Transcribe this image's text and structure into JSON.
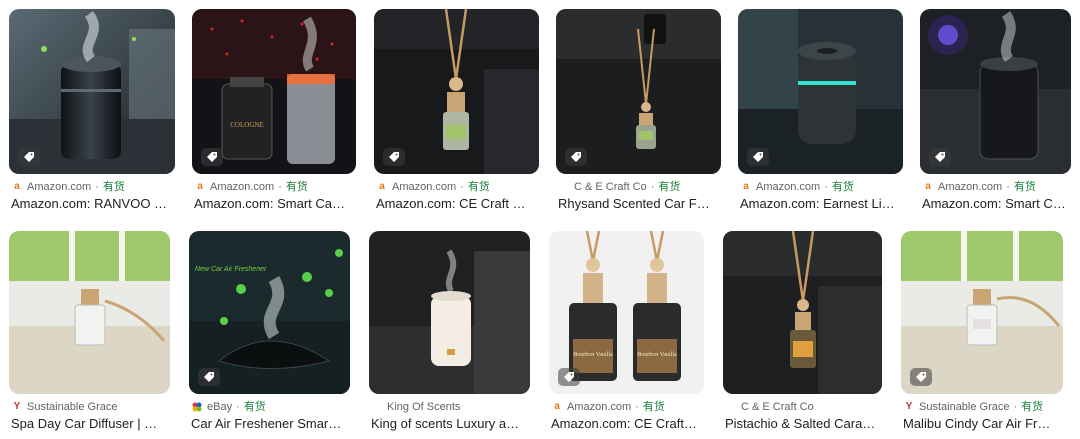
{
  "results": [
    {
      "source": "Amazon.com",
      "stock": "有货",
      "title": "Amazon.com: RANVOO …",
      "fav": "amazon"
    },
    {
      "source": "Amazon.com",
      "stock": "有货",
      "title": "Amazon.com: Smart Ca…",
      "fav": "amazon"
    },
    {
      "source": "Amazon.com",
      "stock": "有货",
      "title": "Amazon.com: CE Craft …",
      "fav": "amazon"
    },
    {
      "source": "C & E Craft Co",
      "stock": "有货",
      "title": "Rhysand Scented Car F…",
      "fav": "none"
    },
    {
      "source": "Amazon.com",
      "stock": "有货",
      "title": "Amazon.com: Earnest Li…",
      "fav": "amazon"
    },
    {
      "source": "Amazon.com",
      "stock": "有货",
      "title": "Amazon.com: Smart Car…",
      "fav": "amazon"
    },
    {
      "source": "Sustainable Grace",
      "stock": "",
      "title": "Spa Day Car Diffuser | …",
      "fav": "grace"
    },
    {
      "source": "eBay",
      "stock": "有货",
      "title": "Car Air Freshener Smar…",
      "fav": "ebay"
    },
    {
      "source": "King Of Scents",
      "stock": "",
      "title": "King of scents Luxury a…",
      "fav": "none"
    },
    {
      "source": "Amazon.com",
      "stock": "有货",
      "title": "Amazon.com: CE Craft…",
      "fav": "amazon"
    },
    {
      "source": "C & E Craft Co",
      "stock": "",
      "title": "Pistachio & Salted Cara…",
      "fav": "none"
    },
    {
      "source": "Sustainable Grace",
      "stock": "有货",
      "title": "Malibu Cindy Car Air Fr…",
      "fav": "grace"
    }
  ],
  "image_labels": {
    "cologne_bottle": "COLOGNE",
    "bourbon_left": "Bourbon Vanilla",
    "bourbon_right": "Bourbon Vanilla",
    "new_car_text": "New Car Air Freshener"
  },
  "colors": {
    "stock_green": "#188038",
    "source_gray": "#5f6368",
    "title": "#202124"
  }
}
